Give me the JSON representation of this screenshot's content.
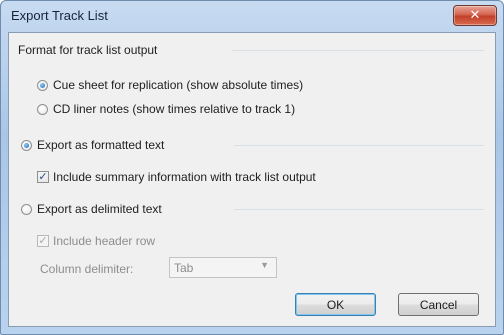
{
  "dialog": {
    "title": "Export Track List",
    "close_glyph": "✕"
  },
  "format_group": {
    "label": "Format for track list output",
    "options": [
      {
        "label": "Cue sheet for replication (show absolute times)",
        "selected": true
      },
      {
        "label": "CD liner notes (show times relative to track 1)",
        "selected": false
      }
    ]
  },
  "export_formatted": {
    "label": "Export as formatted text",
    "selected": true,
    "include_summary": {
      "label": "Include summary information with track list output",
      "checked": true
    }
  },
  "export_delimited": {
    "label": "Export as delimited text",
    "selected": false,
    "include_header": {
      "label": "Include header row",
      "checked": true,
      "enabled": false
    },
    "column_delimiter": {
      "label": "Column delimiter:",
      "value": "Tab",
      "enabled": false
    }
  },
  "buttons": {
    "ok": "OK",
    "cancel": "Cancel"
  },
  "icons": {
    "close": "close-icon",
    "check": "checkmark-icon",
    "dropdown": "chevron-down-icon"
  },
  "colors": {
    "title_bar": "#b9d2ee",
    "close_button": "#c23f28",
    "dialog_background": "#f0f0f0",
    "default_button_border": "#3c7fb1"
  }
}
